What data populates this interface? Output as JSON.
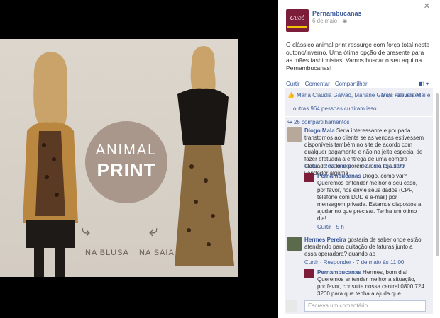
{
  "photo": {
    "badge_line1": "ANIMAL",
    "badge_line2": "PRINT",
    "caption_left": "NA BLUSA",
    "caption_right": "NA SAIA",
    "logo_text": "Cucê"
  },
  "sidebar": {
    "page_name": "Pernambucanas",
    "date": "6 de maio",
    "logo_text": "Cucê",
    "post_text": "O clássico animal print ressurge com força total neste outono/inverno. Uma ótima opção de presente para as mães fashionistas. Vamos buscar o seu aqui na Pernambucanas!",
    "actions": [
      "Curtir",
      "Comentar",
      "Compartilhar"
    ],
    "likes": {
      "names": "Maria Claudia Galvão, Mariane Garcy, Fabiana Mai e",
      "others": "outras 964 pessoas curtiram isso.",
      "most_relevant": "Mais relevantes"
    },
    "shares": "26 compartilhamentos",
    "comments": [
      {
        "author": "Diogo Mala",
        "text": "Seria interessante e poupada transtornos ao cliente se as vendas estivessem disponíveis também no site de acordo com qualquer pagamento e não no jeito especial de fazer efetuada a entrega de uma compra efetuada na loja, porém a uma loja sem vendedor alguma",
        "meta": "Curtir · Responder · 7 de maio às 12:00",
        "reply": {
          "author": "Pernambucanas",
          "text": "Diogo, como vai? Queremos entender melhor o seu caso, por favor, nos envie seus dados (CPF, telefone com DDD e e-mail) por mensagem privada. Estamos dispostos a ajudar no que precisar. Tenha um ótimo dia!",
          "meta": "Curtir · 5 h"
        }
      },
      {
        "author": "Hermes Pereira",
        "text": "gostaria de saber onde estão atendendo para quitação de faturas junto a essa operadora? quando ao",
        "meta": "Curtir · Responder · 7 de maio às 11:00",
        "reply": {
          "author": "Pernambucanas",
          "text": "Hermes, bom dia! Queremos entender melhor a situação, por favor, consulte nossa central 0800 724 3200 para que tenha a ajuda que",
          "meta": ""
        }
      }
    ],
    "input_placeholder": "Escreva um comentário..."
  }
}
